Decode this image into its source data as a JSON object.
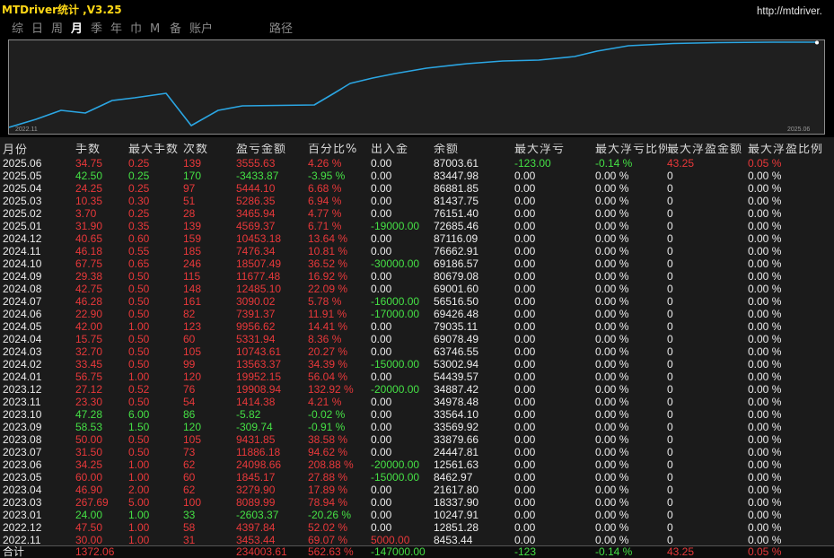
{
  "window": {
    "title": "MTDriver统计 ,V3.25",
    "url": "http://mtdriver."
  },
  "tabs": [
    {
      "label": "综",
      "selected": false
    },
    {
      "label": "日",
      "selected": false
    },
    {
      "label": "周",
      "selected": false
    },
    {
      "label": "月",
      "selected": true
    },
    {
      "label": "季",
      "selected": false
    },
    {
      "label": "年",
      "selected": false
    },
    {
      "label": "巾",
      "selected": false
    },
    {
      "label": "M",
      "selected": false
    },
    {
      "label": "备",
      "selected": false
    },
    {
      "label": "账户",
      "selected": false
    },
    {
      "label": "路径",
      "selected": false
    }
  ],
  "chart": {
    "start_label": "2022.11",
    "end_label": "2025.06"
  },
  "colors": {
    "title": "#ffd816",
    "profit": "#e8383a",
    "loss": "#45e045",
    "neutral": "#ececec",
    "equity_line": "#2ba6e3"
  },
  "table": {
    "columns": [
      "月份",
      "手数",
      "最大手数",
      "次数",
      "盈亏金额",
      "百分比%",
      "出入金",
      "余额",
      "最大浮亏",
      "最大浮亏比例",
      "最大浮盈金额",
      "最大浮盈比例"
    ],
    "rows": [
      [
        "2025.06",
        "34.75",
        "0.25",
        "139",
        "3555.63",
        "4.26 %",
        "0.00",
        "87003.61",
        "-123.00",
        "-0.14 %",
        "43.25",
        "0.05 %"
      ],
      [
        "2025.05",
        "42.50",
        "0.25",
        "170",
        "-3433.87",
        "-3.95 %",
        "0.00",
        "83447.98",
        "0.00",
        "0.00 %",
        "0",
        "0.00 %"
      ],
      [
        "2025.04",
        "24.25",
        "0.25",
        "97",
        "5444.10",
        "6.68 %",
        "0.00",
        "86881.85",
        "0.00",
        "0.00 %",
        "0",
        "0.00 %"
      ],
      [
        "2025.03",
        "10.35",
        "0.30",
        "51",
        "5286.35",
        "6.94 %",
        "0.00",
        "81437.75",
        "0.00",
        "0.00 %",
        "0",
        "0.00 %"
      ],
      [
        "2025.02",
        "3.70",
        "0.25",
        "28",
        "3465.94",
        "4.77 %",
        "0.00",
        "76151.40",
        "0.00",
        "0.00 %",
        "0",
        "0.00 %"
      ],
      [
        "2025.01",
        "31.90",
        "0.35",
        "139",
        "4569.37",
        "6.71 %",
        "-19000.00",
        "72685.46",
        "0.00",
        "0.00 %",
        "0",
        "0.00 %"
      ],
      [
        "2024.12",
        "40.65",
        "0.60",
        "159",
        "10453.18",
        "13.64 %",
        "0.00",
        "87116.09",
        "0.00",
        "0.00 %",
        "0",
        "0.00 %"
      ],
      [
        "2024.11",
        "46.18",
        "0.55",
        "185",
        "7476.34",
        "10.81 %",
        "0.00",
        "76662.91",
        "0.00",
        "0.00 %",
        "0",
        "0.00 %"
      ],
      [
        "2024.10",
        "67.75",
        "0.65",
        "246",
        "18507.49",
        "36.52 %",
        "-30000.00",
        "69186.57",
        "0.00",
        "0.00 %",
        "0",
        "0.00 %"
      ],
      [
        "2024.09",
        "29.38",
        "0.50",
        "115",
        "11677.48",
        "16.92 %",
        "0.00",
        "80679.08",
        "0.00",
        "0.00 %",
        "0",
        "0.00 %"
      ],
      [
        "2024.08",
        "42.75",
        "0.50",
        "148",
        "12485.10",
        "22.09 %",
        "0.00",
        "69001.60",
        "0.00",
        "0.00 %",
        "0",
        "0.00 %"
      ],
      [
        "2024.07",
        "46.28",
        "0.50",
        "161",
        "3090.02",
        "5.78 %",
        "-16000.00",
        "56516.50",
        "0.00",
        "0.00 %",
        "0",
        "0.00 %"
      ],
      [
        "2024.06",
        "22.90",
        "0.50",
        "82",
        "7391.37",
        "11.91 %",
        "-17000.00",
        "69426.48",
        "0.00",
        "0.00 %",
        "0",
        "0.00 %"
      ],
      [
        "2024.05",
        "42.00",
        "1.00",
        "123",
        "9956.62",
        "14.41 %",
        "0.00",
        "79035.11",
        "0.00",
        "0.00 %",
        "0",
        "0.00 %"
      ],
      [
        "2024.04",
        "15.75",
        "0.50",
        "60",
        "5331.94",
        "8.36 %",
        "0.00",
        "69078.49",
        "0.00",
        "0.00 %",
        "0",
        "0.00 %"
      ],
      [
        "2024.03",
        "32.70",
        "0.50",
        "105",
        "10743.61",
        "20.27 %",
        "0.00",
        "63746.55",
        "0.00",
        "0.00 %",
        "0",
        "0.00 %"
      ],
      [
        "2024.02",
        "33.45",
        "0.50",
        "99",
        "13563.37",
        "34.39 %",
        "-15000.00",
        "53002.94",
        "0.00",
        "0.00 %",
        "0",
        "0.00 %"
      ],
      [
        "2024.01",
        "56.75",
        "1.00",
        "120",
        "19952.15",
        "56.04 %",
        "0.00",
        "54439.57",
        "0.00",
        "0.00 %",
        "0",
        "0.00 %"
      ],
      [
        "2023.12",
        "27.12",
        "0.52",
        "76",
        "19908.94",
        "132.92 %",
        "-20000.00",
        "34887.42",
        "0.00",
        "0.00 %",
        "0",
        "0.00 %"
      ],
      [
        "2023.11",
        "23.30",
        "0.50",
        "54",
        "1414.38",
        "4.21 %",
        "0.00",
        "34978.48",
        "0.00",
        "0.00 %",
        "0",
        "0.00 %"
      ],
      [
        "2023.10",
        "47.28",
        "6.00",
        "86",
        "-5.82",
        "-0.02 %",
        "0.00",
        "33564.10",
        "0.00",
        "0.00 %",
        "0",
        "0.00 %"
      ],
      [
        "2023.09",
        "58.53",
        "1.50",
        "120",
        "-309.74",
        "-0.91 %",
        "0.00",
        "33569.92",
        "0.00",
        "0.00 %",
        "0",
        "0.00 %"
      ],
      [
        "2023.08",
        "50.00",
        "0.50",
        "105",
        "9431.85",
        "38.58 %",
        "0.00",
        "33879.66",
        "0.00",
        "0.00 %",
        "0",
        "0.00 %"
      ],
      [
        "2023.07",
        "31.50",
        "0.50",
        "73",
        "11886.18",
        "94.62 %",
        "0.00",
        "24447.81",
        "0.00",
        "0.00 %",
        "0",
        "0.00 %"
      ],
      [
        "2023.06",
        "34.25",
        "1.00",
        "62",
        "24098.66",
        "208.88 %",
        "-20000.00",
        "12561.63",
        "0.00",
        "0.00 %",
        "0",
        "0.00 %"
      ],
      [
        "2023.05",
        "60.00",
        "1.00",
        "60",
        "1845.17",
        "27.88 %",
        "-15000.00",
        "8462.97",
        "0.00",
        "0.00 %",
        "0",
        "0.00 %"
      ],
      [
        "2023.04",
        "46.90",
        "2.00",
        "62",
        "3279.90",
        "17.89 %",
        "0.00",
        "21617.80",
        "0.00",
        "0.00 %",
        "0",
        "0.00 %"
      ],
      [
        "2023.03",
        "267.69",
        "5.00",
        "100",
        "8089.99",
        "78.94 %",
        "0.00",
        "18337.90",
        "0.00",
        "0.00 %",
        "0",
        "0.00 %"
      ],
      [
        "2023.01",
        "24.00",
        "1.00",
        "33",
        "-2603.37",
        "-20.26 %",
        "0.00",
        "10247.91",
        "0.00",
        "0.00 %",
        "0",
        "0.00 %"
      ],
      [
        "2022.12",
        "47.50",
        "1.00",
        "58",
        "4397.84",
        "52.02 %",
        "0.00",
        "12851.28",
        "0.00",
        "0.00 %",
        "0",
        "0.00 %"
      ],
      [
        "2022.11",
        "30.00",
        "1.00",
        "31",
        "3453.44",
        "69.07 %",
        "5000.00",
        "8453.44",
        "0.00",
        "0.00 %",
        "0",
        "0.00 %"
      ]
    ],
    "total": [
      "合计",
      "1372.06",
      "",
      "",
      "234003.61",
      "562.63 %",
      "-147000.00",
      "",
      "-123",
      "-0.14 %",
      "43.25",
      "0.05 %"
    ]
  }
}
